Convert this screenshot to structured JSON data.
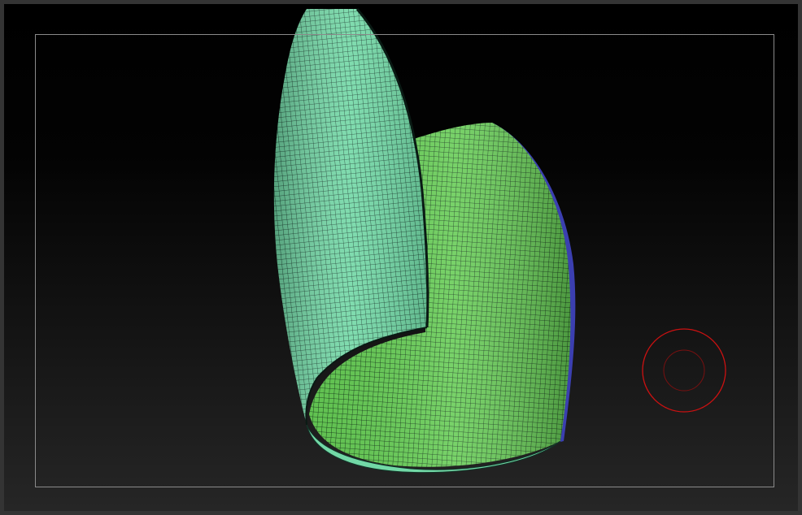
{
  "viewport": {
    "background_top": "#000000",
    "background_bottom": "#262626",
    "frame_color": "#8a8a8a"
  },
  "mesh": {
    "front_panel_color": "#6fd6a2",
    "back_panel_color": "#66cc55",
    "edge_color": "#3b3fb0",
    "wireframe_color": "#0b2a12"
  },
  "brush_cursor": {
    "color": "#cc1111"
  }
}
